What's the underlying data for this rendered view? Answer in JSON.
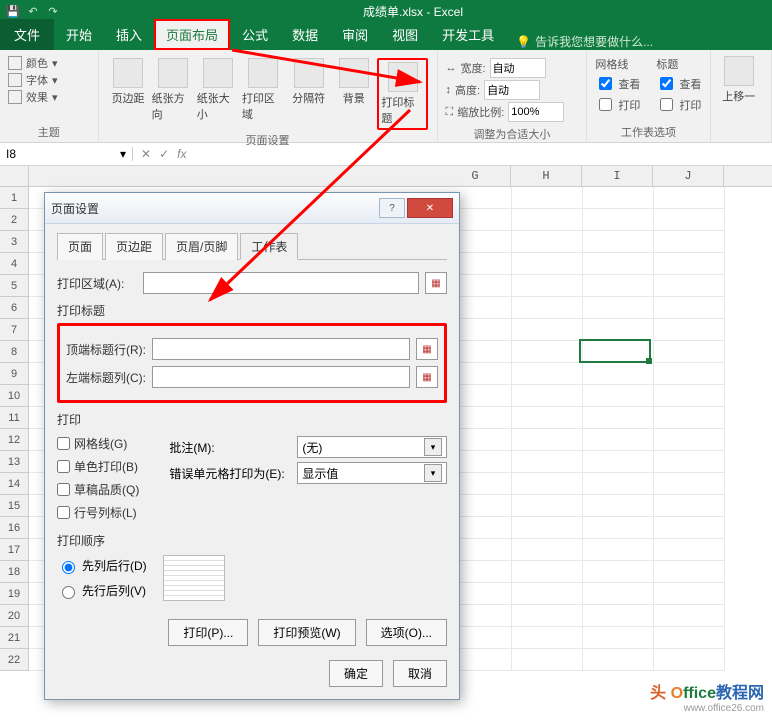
{
  "app": {
    "title": "成绩单.xlsx - Excel"
  },
  "qat": {
    "save": "💾",
    "undo": "↶",
    "redo": "↷"
  },
  "tabs": {
    "file": "文件",
    "items": [
      "开始",
      "插入",
      "页面布局",
      "公式",
      "数据",
      "审阅",
      "视图",
      "开发工具"
    ],
    "active_index": 2,
    "tell_me_icon": "💡",
    "tell_me": "告诉我您想要做什么..."
  },
  "ribbon": {
    "theme": {
      "colors": "颜色",
      "fonts": "字体",
      "effects": "效果",
      "label": "主题"
    },
    "page_setup": {
      "margins": "页边距",
      "orientation": "纸张方向",
      "size": "纸张大小",
      "print_area": "打印区域",
      "breaks": "分隔符",
      "background": "背景",
      "print_titles": "打印标题",
      "label": "页面设置"
    },
    "scale": {
      "width_lbl": "宽度:",
      "width_val": "自动",
      "height_lbl": "高度:",
      "height_val": "自动",
      "scale_lbl": "缩放比例:",
      "scale_val": "100%",
      "label": "调整为合适大小"
    },
    "sheet_opts": {
      "gridlines": "网格线",
      "headings": "标题",
      "view": "查看",
      "print": "打印",
      "label": "工作表选项"
    },
    "arrange": {
      "forward": "上移一"
    }
  },
  "namebox": {
    "value": "I8"
  },
  "fx": {
    "label": "fx"
  },
  "columns": [
    "G",
    "H",
    "I",
    "J"
  ],
  "rows": [
    "1",
    "2",
    "3",
    "4",
    "5",
    "6",
    "7",
    "8",
    "9",
    "10",
    "11",
    "12",
    "13",
    "14",
    "15",
    "16",
    "17",
    "18",
    "19",
    "20",
    "21",
    "22"
  ],
  "dialog": {
    "title": "页面设置",
    "help": "?",
    "close": "✕",
    "tabs": [
      "页面",
      "页边距",
      "页眉/页脚",
      "工作表"
    ],
    "active_tab_index": 3,
    "print_area_lbl": "打印区域(A):",
    "print_area_val": "",
    "titles_section": "打印标题",
    "top_rows_lbl": "顶端标题行(R):",
    "top_rows_val": "",
    "left_cols_lbl": "左端标题列(C):",
    "left_cols_val": "",
    "print_section": "打印",
    "gridlines": "网格线(G)",
    "bw": "单色打印(B)",
    "draft": "草稿品质(Q)",
    "row_col_hdr": "行号列标(L)",
    "comments_lbl": "批注(M):",
    "comments_val": "(无)",
    "errors_lbl": "错误单元格打印为(E):",
    "errors_val": "显示值",
    "order_section": "打印顺序",
    "order_down": "先列后行(D)",
    "order_over": "先行后列(V)",
    "print_btn": "打印(P)...",
    "preview_btn": "打印预览(W)",
    "options_btn": "选项(O)...",
    "ok": "确定",
    "cancel": "取消"
  },
  "watermark": {
    "brand1": "O",
    "brand2": "ffice",
    "brand3": "教程网",
    "url": "www.office26.com"
  }
}
